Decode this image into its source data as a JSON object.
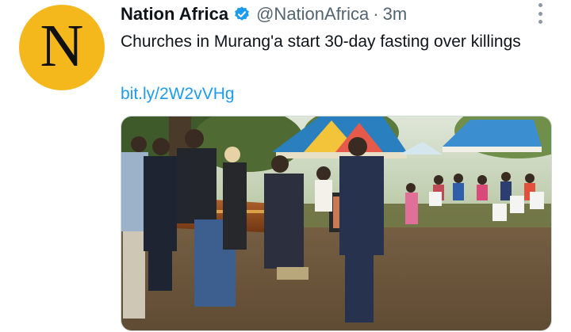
{
  "tweet": {
    "avatar_letter": "N",
    "display_name": "Nation Africa",
    "handle": "@NationAfrica",
    "separator": "·",
    "time": "3m",
    "text": "Churches in Murang'a start 30-day fasting over killings",
    "link": "bit.ly/2W2vVHg",
    "icons": {
      "verified": "verified-badge-icon",
      "more": "more-options-icon"
    },
    "colors": {
      "avatar_bg": "#f5b81c",
      "link": "#1d9bf0",
      "verified": "#1d9bf0"
    }
  }
}
